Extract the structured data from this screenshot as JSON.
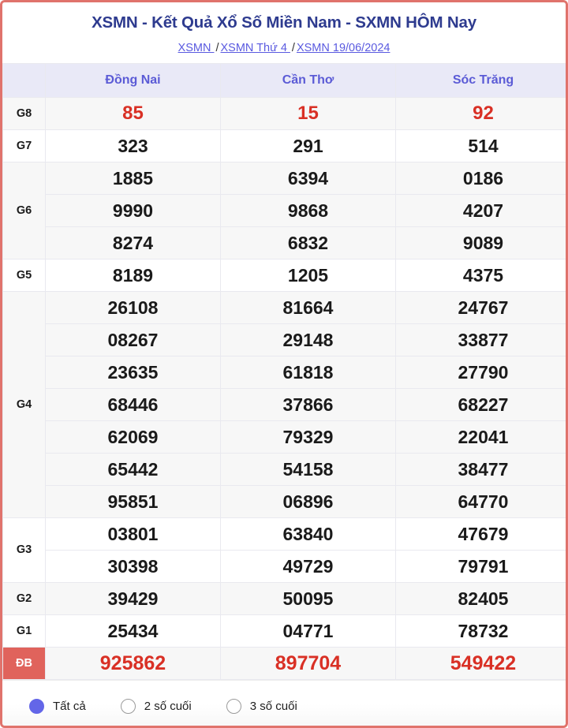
{
  "header": {
    "title": "XSMN - Kết Quả Xổ Số Miền Nam - SXMN HÔM Nay",
    "breadcrumb": [
      {
        "label": "XSMN "
      },
      {
        "label": "XSMN Thứ 4 "
      },
      {
        "label": "XSMN 19/06/2024"
      }
    ],
    "separator": "/"
  },
  "table": {
    "corner_label": "",
    "provinces": [
      "Đồng Nai",
      "Cần Thơ",
      "Sóc Trăng"
    ],
    "rows": [
      {
        "prize": "G8",
        "highlight": true,
        "values": [
          [
            "85"
          ],
          [
            "15"
          ],
          [
            "92"
          ]
        ]
      },
      {
        "prize": "G7",
        "highlight": false,
        "values": [
          [
            "323"
          ],
          [
            "291"
          ],
          [
            "514"
          ]
        ]
      },
      {
        "prize": "G6",
        "highlight": false,
        "values": [
          [
            "1885",
            "9990",
            "8274"
          ],
          [
            "6394",
            "9868",
            "6832"
          ],
          [
            "0186",
            "4207",
            "9089"
          ]
        ]
      },
      {
        "prize": "G5",
        "highlight": false,
        "values": [
          [
            "8189"
          ],
          [
            "1205"
          ],
          [
            "4375"
          ]
        ]
      },
      {
        "prize": "G4",
        "highlight": false,
        "values": [
          [
            "26108",
            "08267",
            "23635",
            "68446",
            "62069",
            "65442",
            "95851"
          ],
          [
            "81664",
            "29148",
            "61818",
            "37866",
            "79329",
            "54158",
            "06896"
          ],
          [
            "24767",
            "33877",
            "27790",
            "68227",
            "22041",
            "38477",
            "64770"
          ]
        ]
      },
      {
        "prize": "G3",
        "highlight": false,
        "values": [
          [
            "03801",
            "30398"
          ],
          [
            "63840",
            "49729"
          ],
          [
            "47679",
            "79791"
          ]
        ]
      },
      {
        "prize": "G2",
        "highlight": false,
        "values": [
          [
            "39429"
          ],
          [
            "50095"
          ],
          [
            "82405"
          ]
        ]
      },
      {
        "prize": "G1",
        "highlight": false,
        "values": [
          [
            "25434"
          ],
          [
            "04771"
          ],
          [
            "78732"
          ]
        ]
      },
      {
        "prize": "ĐB",
        "highlight": true,
        "values": [
          [
            "925862"
          ],
          [
            "897704"
          ],
          [
            "549422"
          ]
        ]
      }
    ]
  },
  "footer": {
    "options": [
      {
        "label": "Tất cả",
        "selected": true
      },
      {
        "label": "2 số cuối",
        "selected": false
      },
      {
        "label": "3 số cuối",
        "selected": false
      }
    ]
  },
  "colors": {
    "title": "#2e3b8f",
    "link": "#5a5ae0",
    "province_header_text": "#5b5bd6",
    "province_header_bg": "#e9e9f7",
    "hot_number": "#d93025",
    "db_label_bg": "#e0635c",
    "card_border": "#e0736c",
    "radio_selected": "#6366e8",
    "stripe_bg": "#f7f7f7"
  }
}
